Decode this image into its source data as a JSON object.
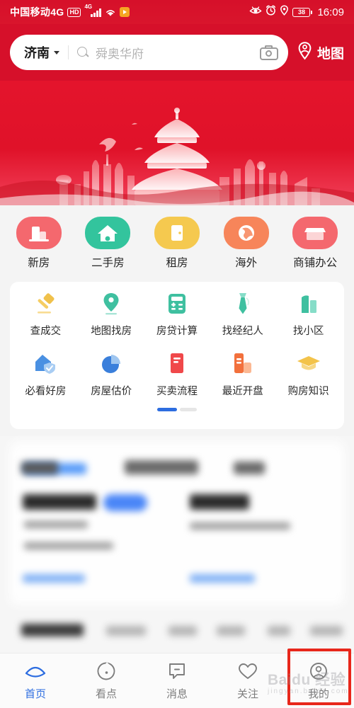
{
  "status_bar": {
    "carrier": "中国移动4G",
    "hd_badge": "HD",
    "network_type": "4G",
    "signal_icon": "signal-bars-icon",
    "wifi_icon": "wifi-icon",
    "app_icon": "media-play-icon",
    "eye_comfort_icon": "eye-comfort-icon",
    "alarm_icon": "alarm-clock-icon",
    "location_icon": "location-pin-icon",
    "battery_level": "38",
    "time": "16:09"
  },
  "header": {
    "city": "济南",
    "city_caret_icon": "chevron-down-icon",
    "search_icon": "search-icon",
    "search_value": "",
    "search_placeholder": "舜奥华府",
    "camera_icon": "camera-icon",
    "map_icon": "map-person-pin-icon",
    "map_label": "地图",
    "background_color": "#d6102a"
  },
  "banner": {
    "name": "temple-of-heaven-skyline-banner",
    "alt": "红色天坛城市剪影横幅",
    "colors": {
      "top": "#e8152c",
      "bottom": "#c90e26",
      "silhouette": "#ffb4b4"
    }
  },
  "categories": [
    {
      "label": "新房",
      "icon": "new-house-icon",
      "color": "#f4686e"
    },
    {
      "label": "二手房",
      "icon": "second-hand-house-icon",
      "color": "#33c49d"
    },
    {
      "label": "租房",
      "icon": "rent-house-icon",
      "color": "#f6c košt"
    },
    {
      "label": "海外",
      "icon": "overseas-globe-icon",
      "color": "#f7855a"
    },
    {
      "label": "商铺办公",
      "icon": "shop-office-icon",
      "color": "#f4686e"
    }
  ],
  "category_colors": [
    "#f4686e",
    "#33c49d",
    "#f5c94f",
    "#f7855a",
    "#f4686e"
  ],
  "quick_menu": {
    "row1": [
      {
        "label": "查成交",
        "icon": "gavel-icon",
        "color": "#f0c14b"
      },
      {
        "label": "地图找房",
        "icon": "map-pin-icon",
        "color": "#3fc0a0"
      },
      {
        "label": "房贷计算",
        "icon": "calculator-icon",
        "color": "#3fc0a0"
      },
      {
        "label": "找经纪人",
        "icon": "necktie-agent-icon",
        "color": "#6fd3bb"
      },
      {
        "label": "找小区",
        "icon": "community-buildings-icon",
        "color": "#3fc0a0"
      }
    ],
    "row2": [
      {
        "label": "必看好房",
        "icon": "house-shield-icon",
        "color": "#4a90e2"
      },
      {
        "label": "房屋估价",
        "icon": "pie-chart-icon",
        "color": "#3a7fdb"
      },
      {
        "label": "买卖流程",
        "icon": "red-book-icon",
        "color": "#f0484a"
      },
      {
        "label": "最近开盘",
        "icon": "bar-chart-icon",
        "color": "#f2703c"
      },
      {
        "label": "购房知识",
        "icon": "graduation-cap-icon",
        "color": "#f3c34a"
      }
    ],
    "pager": {
      "pages": 2,
      "active_index": 0,
      "active_color": "#2d6de0",
      "inactive_color": "#e6e6e6"
    }
  },
  "feed": {
    "state": "blurred",
    "note": "内容区域已模糊处理"
  },
  "tabbar": [
    {
      "label": "首页",
      "icon": "home-icon",
      "active": true
    },
    {
      "label": "看点",
      "icon": "discover-icon",
      "active": false
    },
    {
      "label": "消息",
      "icon": "message-icon",
      "active": false
    },
    {
      "label": "关注",
      "icon": "heart-follow-icon",
      "active": false
    },
    {
      "label": "我的",
      "icon": "profile-icon",
      "active": false
    }
  ],
  "annotation": {
    "highlight_target": "我的",
    "highlight_color": "#e8271b"
  },
  "watermark": {
    "text": "Baidu 经验",
    "subtext": "jingyan.baidu.com"
  }
}
